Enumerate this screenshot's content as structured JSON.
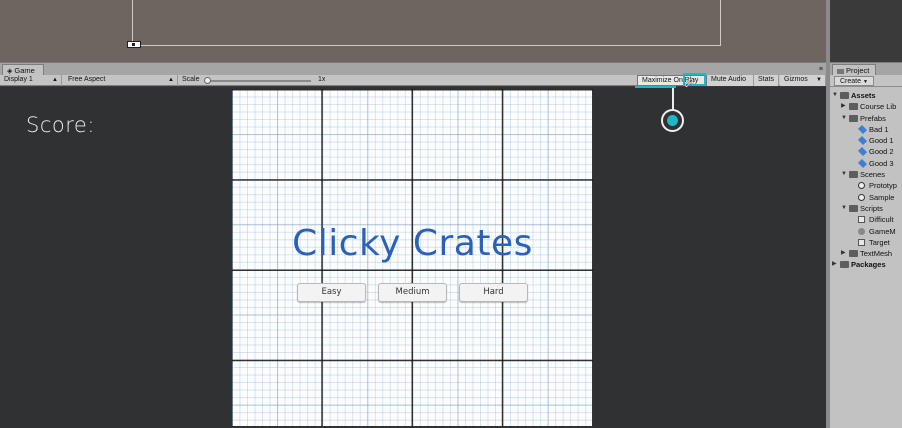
{
  "game_panel": {
    "tab_label": "Game",
    "menu_glyph": "≡",
    "toolbar": {
      "display": "Display 1",
      "aspect": "Free Aspect",
      "scale_label": "Scale",
      "scale_value": "1x",
      "maximize_on_play": "Maximize On Play",
      "mute_audio": "Mute Audio",
      "stats": "Stats",
      "gizmos": "Gizmos"
    }
  },
  "game_view": {
    "score_label": "Score:",
    "title": "Clicky Crates",
    "buttons": [
      "Easy",
      "Medium",
      "Hard"
    ]
  },
  "project_panel": {
    "tab_label": "Project",
    "create_button": "Create",
    "tree": [
      {
        "label": "Assets",
        "icon": "folder-icon",
        "expanded": true,
        "bold": true,
        "depth": 0
      },
      {
        "label": "Course Lib",
        "icon": "folder-icon",
        "expanded": false,
        "depth": 1
      },
      {
        "label": "Prefabs",
        "icon": "folder-icon",
        "expanded": true,
        "depth": 1
      },
      {
        "label": "Bad 1",
        "icon": "prefab-icon",
        "depth": 2
      },
      {
        "label": "Good 1",
        "icon": "prefab-icon",
        "depth": 2
      },
      {
        "label": "Good 2",
        "icon": "prefab-icon",
        "depth": 2
      },
      {
        "label": "Good 3",
        "icon": "prefab-icon",
        "depth": 2
      },
      {
        "label": "Scenes",
        "icon": "folder-icon",
        "expanded": true,
        "depth": 1
      },
      {
        "label": "Prototyp",
        "icon": "scene-icon",
        "depth": 2
      },
      {
        "label": "Sample",
        "icon": "scene-icon",
        "depth": 2
      },
      {
        "label": "Scripts",
        "icon": "folder-icon",
        "expanded": true,
        "depth": 1
      },
      {
        "label": "Difficult",
        "icon": "script-icon",
        "depth": 2
      },
      {
        "label": "GameM",
        "icon": "gear-icon",
        "depth": 2
      },
      {
        "label": "Target",
        "icon": "script-icon",
        "depth": 2
      },
      {
        "label": "TextMesh",
        "icon": "folder-icon",
        "expanded": false,
        "depth": 1
      },
      {
        "label": "Packages",
        "icon": "folder-icon",
        "expanded": false,
        "bold": true,
        "depth": 0
      }
    ]
  },
  "colors": {
    "accent": "#1fb6c8",
    "title_blue": "#2b62b8",
    "game_bg": "#2f3133"
  }
}
